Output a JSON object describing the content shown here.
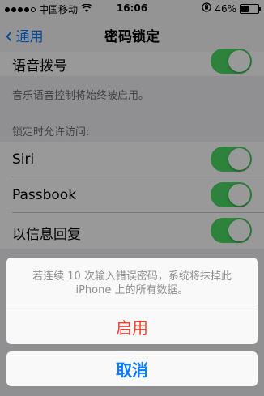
{
  "status_bar": {
    "carrier": "中国移动",
    "time": "16:06",
    "battery_percent": "46%",
    "battery_level": 0.46
  },
  "nav": {
    "back_label": "通用",
    "title": "密码锁定"
  },
  "rows": {
    "voice_dial": {
      "label": "语音拨号",
      "on": true
    },
    "voice_dial_footer": "音乐语音控制将始终被启用。",
    "lock_access_header": "锁定时允许访问:",
    "siri": {
      "label": "Siri",
      "on": true
    },
    "passbook": {
      "label": "Passbook",
      "on": true
    },
    "reply_message": {
      "label": "以信息回复",
      "on": true
    }
  },
  "action_sheet": {
    "message": "若连续 10 次输入错误密码，系统将抹掉此 iPhone 上的所有数据。",
    "enable_label": "启用",
    "cancel_label": "取消"
  },
  "colors": {
    "ios_blue": "#0a7aff",
    "destructive_red": "#ff3b30",
    "toggle_green": "#4cd964"
  }
}
